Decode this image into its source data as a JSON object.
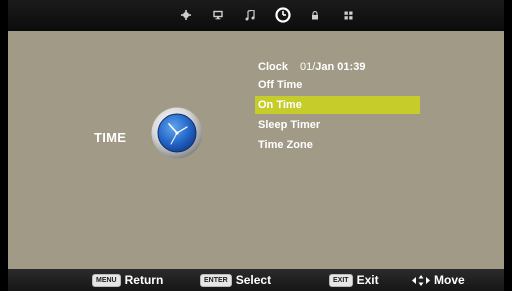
{
  "tabs": [
    {
      "icon": "gear-icon"
    },
    {
      "icon": "monitor-icon"
    },
    {
      "icon": "music-note-icon"
    },
    {
      "icon": "clock-icon",
      "active": true
    },
    {
      "icon": "lock-icon"
    },
    {
      "icon": "grid-icon"
    }
  ],
  "section": {
    "label": "TIME",
    "icon": "clock-icon"
  },
  "menu": {
    "clock_label": "Clock",
    "clock_date": "01/",
    "clock_month": "Jan",
    "clock_time": "01:39",
    "items": [
      {
        "label": "Off Time"
      },
      {
        "label": "On Time",
        "selected": true
      },
      {
        "label": "Sleep Timer"
      },
      {
        "label": "Time Zone"
      }
    ]
  },
  "footer": {
    "return": {
      "key": "MENU",
      "label": "Return"
    },
    "select": {
      "key": "ENTER",
      "label": "Select"
    },
    "exit": {
      "key": "EXIT",
      "label": "Exit"
    },
    "move": {
      "icon": "move-arrows-icon",
      "label": "Move"
    }
  },
  "colors": {
    "panel": "#a19a86",
    "highlight": "#c6cd2a",
    "bar": "#111111"
  }
}
